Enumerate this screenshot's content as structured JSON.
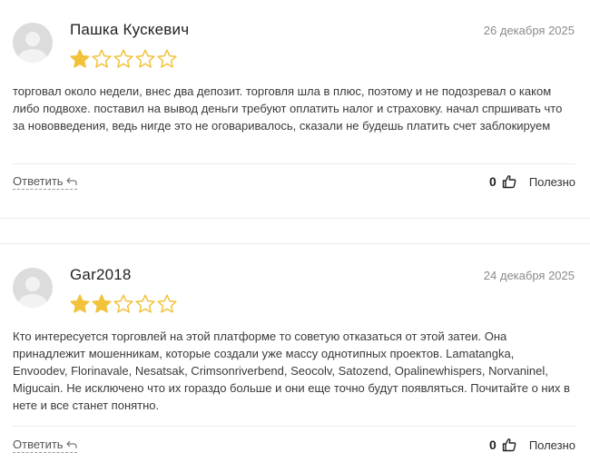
{
  "colors": {
    "star_filled": "#f2c23a",
    "star_empty_stroke": "#f2c23a",
    "avatar_bg": "#dcdcdc"
  },
  "reviews": [
    {
      "author": "Пашка Кускевич",
      "date": "26 декабря 2025",
      "rating": 1,
      "max_rating": 5,
      "text": "торговал около недели, внес два депозит. торговля шла в плюс, поэтому и не подозревал о каком либо подвохе. поставил на вывод деньги требуют оплатить налог и страховку. начал спршивать что за нововведения, ведь нигде это не оговаривалось, сказали не будешь платить счет заблокируем",
      "reply_label": "Ответить",
      "like_count": "0",
      "useful_label": "Полезно"
    },
    {
      "author": "Gar2018",
      "date": "24 декабря 2025",
      "rating": 2,
      "max_rating": 5,
      "text": "Кто интересуется торговлей на этой платформе то советую отказаться от этой затеи. Она принадлежит мошенникам, которые создали уже массу однотипных проектов. Lamatangka, Envoodev, Florinavale, Nesatsak, Crimsonriverbend, Seocolv, Satozend, Opalinewhispers, Norvaninel, Migucain. Не исключено что их гораздо больше и они еще точно будут появляться. Почитайте о них в нете и все станет понятно.",
      "reply_label": "Ответить",
      "like_count": "0",
      "useful_label": "Полезно"
    }
  ]
}
